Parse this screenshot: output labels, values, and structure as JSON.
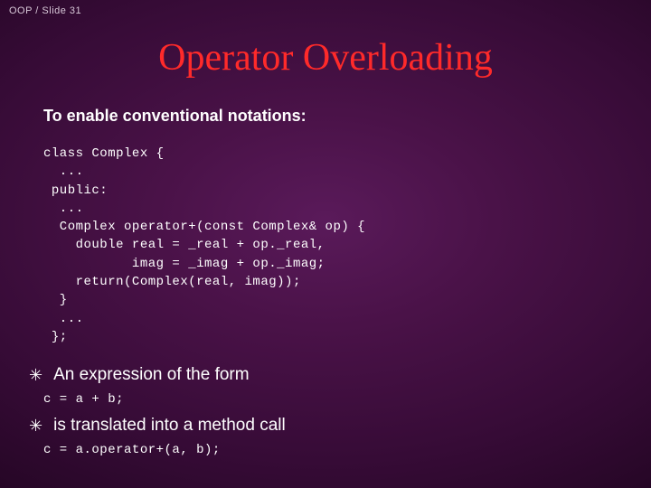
{
  "header": "OOP / Slide 31",
  "title": "Operator Overloading",
  "subtitle": "To enable conventional notations:",
  "code_main": "class Complex {\n  ...\n public:\n  ...\n  Complex operator+(const Complex& op) {\n    double real = _real + op._real,\n           imag = _imag + op._imag;\n    return(Complex(real, imag));\n  }\n  ...\n };",
  "bullet1": "An expression of the form",
  "code_expr1": "c = a + b;",
  "bullet2": "is translated into a method call",
  "code_expr2": "c = a.operator+(a, b);",
  "bullet_symbol": "✳"
}
